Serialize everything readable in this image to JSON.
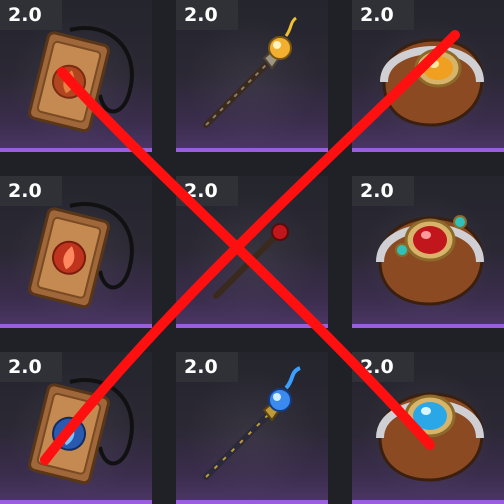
{
  "inventory": {
    "slots": [
      {
        "level": "2.0",
        "item": "tablet-amulet"
      },
      {
        "level": "2.0",
        "item": "staff"
      },
      {
        "level": "2.0",
        "item": "bracer"
      },
      {
        "level": "2.0",
        "item": "tablet-amulet"
      },
      {
        "level": "2.0",
        "item": "staff"
      },
      {
        "level": "2.0",
        "item": "bracer"
      },
      {
        "level": "2.0",
        "item": "tablet-amulet"
      },
      {
        "level": "2.0",
        "item": "staff"
      },
      {
        "level": "2.0",
        "item": "bracer"
      }
    ]
  },
  "colors": {
    "rarity_bar": "#9b5de0",
    "cross_mark": "#ff1010",
    "gem_orange": "#f0a020",
    "gem_red": "#c0161c",
    "gem_blue": "#29a7e6"
  }
}
